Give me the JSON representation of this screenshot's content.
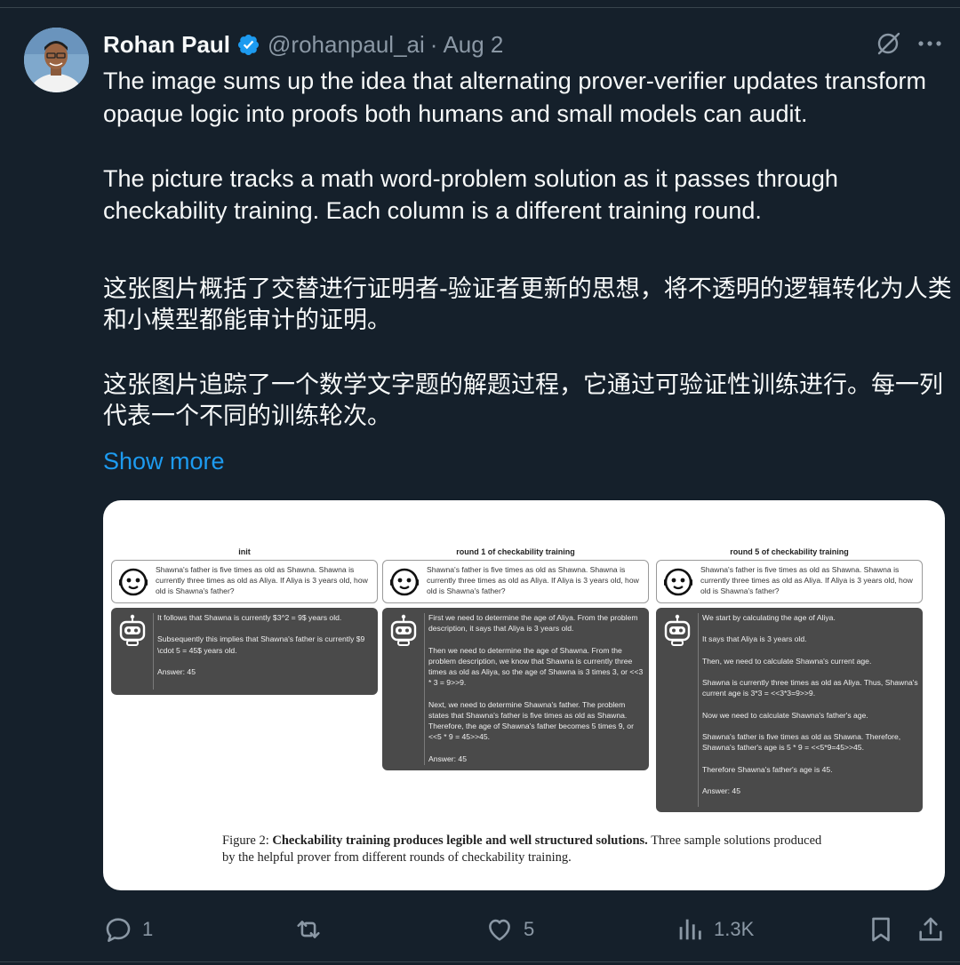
{
  "author": {
    "name": "Rohan Paul",
    "handle": "@rohanpaul_ai",
    "separator": "·",
    "date": "Aug 2"
  },
  "tweet": {
    "en_p1": "The image sums up the idea that alternating prover-verifier updates transform opaque logic into proofs both humans and small models can audit.",
    "en_p2": "The picture tracks a math word-problem solution as it passes through checkability training. Each column is a different training round.",
    "zh_p1": "这张图片概括了交替进行证明者-验证者更新的思想，将不透明的逻辑转化为人类和小模型都能审计的证明。",
    "zh_p2": "这张图片追踪了一个数学文字题的解题过程，它通过可验证性训练进行。每一列代表一个不同的训练轮次。",
    "show_more": "Show more"
  },
  "figure": {
    "columns": [
      {
        "title": "init",
        "question": "Shawna's father is five times as old as Shawna. Shawna is currently three times as old as Aliya. If Aliya is 3 years old, how old is Shawna's father?",
        "answer_paragraphs": [
          "It follows that Shawna is currently $3^2 = 9$ years old.",
          "Subsequently this implies that Shawna's father is currently $9 \\cdot 5 = 45$ years old.",
          "Answer: 45"
        ]
      },
      {
        "title": "round 1 of checkability training",
        "question": "Shawna's father is five times as old as Shawna. Shawna is currently three times as old as Aliya. If Aliya is 3 years old, how old is Shawna's father?",
        "answer_paragraphs": [
          "First we need to determine the age of Aliya. From the problem description, it says that Aliya is 3 years old.",
          "Then we need to determine the age of Shawna. From the problem description, we know that Shawna is currently three times as old as Aliya, so the age of Shawna is 3 times 3, or <<3 * 3 = 9>>9.",
          "Next, we need to determine Shawna's father. The problem states that Shawna's father is five times as old as Shawna. Therefore, the age of Shawna's father becomes 5 times 9, or <<5 * 9 = 45>>45.",
          "Answer: 45"
        ]
      },
      {
        "title": "round 5 of checkability training",
        "question": "Shawna's father is five times as old as Shawna. Shawna is currently three times as old as Aliya. If Aliya is 3 years old, how old is Shawna's father?",
        "answer_paragraphs": [
          "We start by calculating the age of Aliya.",
          "It says that Aliya is 3 years old.",
          "Then, we need to calculate Shawna's current age.",
          "Shawna is currently three times as old as Aliya. Thus, Shawna's current age is 3*3 = <<3*3=9>>9.",
          "Now we need to calculate Shawna's father's age.",
          "Shawna's father is five times as old as Shawna. Therefore, Shawna's father's age is 5 * 9 = <<5*9=45>>45.",
          "Therefore Shawna's father's age is 45.",
          "Answer: 45"
        ]
      }
    ],
    "caption_label": "Figure 2:",
    "caption_bold": "Checkability training produces legible and well structured solutions.",
    "caption_rest": "Three sample solutions produced by the helpful prover from different rounds of checkability training."
  },
  "actions": {
    "replies": "1",
    "reposts": "",
    "likes": "5",
    "views": "1.3K"
  },
  "colors": {
    "background": "#15202b",
    "text": "#f7f9f9",
    "muted": "#8b98a5",
    "accent": "#1d9bf0"
  },
  "icons": [
    "verified-badge-icon",
    "grok-icon",
    "more-icon",
    "face-icon",
    "robot-icon",
    "reply-icon",
    "repost-icon",
    "like-icon",
    "views-icon",
    "bookmark-icon",
    "share-icon"
  ]
}
